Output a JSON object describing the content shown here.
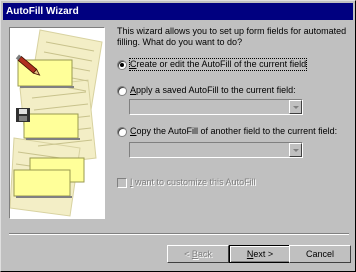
{
  "window": {
    "title": "AutoFill Wizard"
  },
  "intro": {
    "text": "This wizard allows you to set up form fields for automated filling. What do you want to do?"
  },
  "options": [
    {
      "accel": "C",
      "rest": "reate or edit the AutoFill of the current field",
      "selected": true
    },
    {
      "accel": "A",
      "rest": "pply a saved AutoFill to the current field:",
      "selected": false
    },
    {
      "accel": "C",
      "rest": "opy the AutoFill of another field to the current field:",
      "selected": false
    }
  ],
  "combos": [
    {
      "value": ""
    },
    {
      "value": ""
    }
  ],
  "customize": {
    "accel": "I",
    "rest": " want to customize this AutoFill",
    "checked": false
  },
  "buttons": {
    "back": {
      "prefix": "< ",
      "accel": "B",
      "rest": "ack"
    },
    "next": {
      "accel": "N",
      "rest": "ext >"
    },
    "cancel": {
      "label": "Cancel"
    }
  },
  "icons": {
    "pencil": "pencil-icon",
    "floppy": "floppy-disk-icon"
  },
  "colors": {
    "titlebar": "#000080",
    "face": "#c0c0c0",
    "note": "#ffff99",
    "paper": "#f5f0c8"
  }
}
